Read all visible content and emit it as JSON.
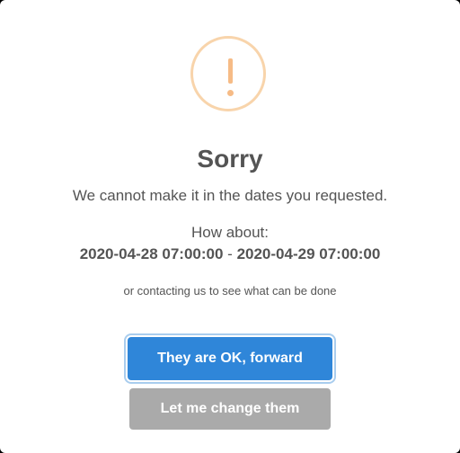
{
  "dialog": {
    "title": "Sorry",
    "message": "We cannot make it in the dates you requested.",
    "suggestion_label": "How about:",
    "suggested_start": "2020-04-28 07:00:00",
    "date_separator": "-",
    "suggested_end": "2020-04-29 07:00:00",
    "contact_text": "or contacting us to see what can be done",
    "confirm_label": "They are OK, forward",
    "change_label": "Let me change them",
    "icon": "warning-exclamation-icon"
  },
  "colors": {
    "icon_border": "#f8d4ab",
    "icon_mark": "#f6bb86",
    "confirm_button": "#2f86d9",
    "change_button": "#aaaaaa",
    "text": "#545454"
  }
}
